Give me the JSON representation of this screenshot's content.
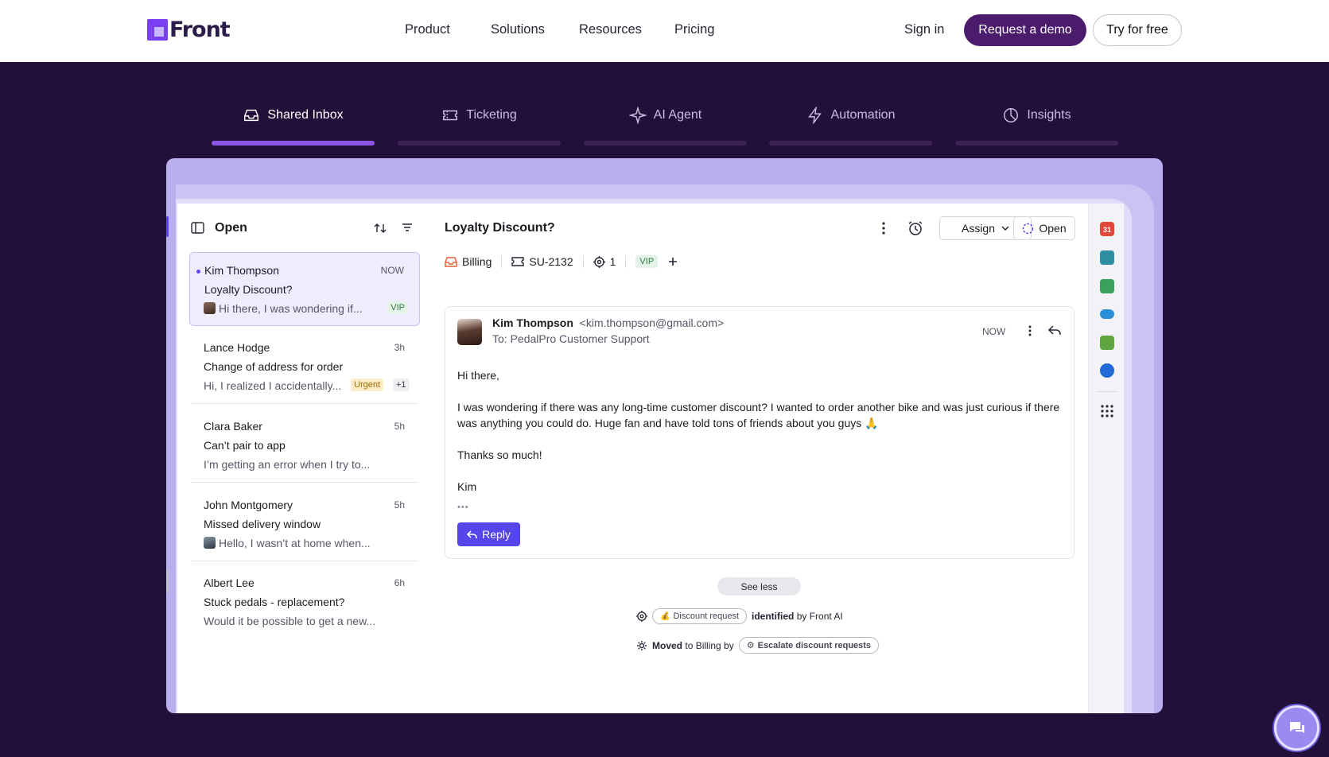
{
  "nav": {
    "logo": "Front",
    "links": [
      "Product",
      "Solutions",
      "Resources",
      "Pricing"
    ],
    "sign_in": "Sign in",
    "demo": "Request a demo",
    "try": "Try for free"
  },
  "tabs": [
    {
      "label": "Shared Inbox",
      "icon": "inbox-icon",
      "active": true
    },
    {
      "label": "Ticketing",
      "icon": "ticket-icon",
      "active": false
    },
    {
      "label": "AI Agent",
      "icon": "sparkle-icon",
      "active": false
    },
    {
      "label": "Automation",
      "icon": "bolt-icon",
      "active": false
    },
    {
      "label": "Insights",
      "icon": "pie-chart-icon",
      "active": false
    }
  ],
  "inbox": {
    "title": "Open",
    "conversations": [
      {
        "name": "Kim Thompson",
        "time": "NOW",
        "subject": "Loyalty Discount?",
        "preview": "Hi there, I was wondering if...",
        "badge": "VIP",
        "extra": ""
      },
      {
        "name": "Lance Hodge",
        "time": "3h",
        "subject": "Change of address for order",
        "preview": "Hi, I realized I accidentally...",
        "badge": "Urgent",
        "extra": "+1"
      },
      {
        "name": "Clara Baker",
        "time": "5h",
        "subject": "Can’t pair to app",
        "preview": "I’m getting an error when I try to...",
        "badge": "",
        "extra": ""
      },
      {
        "name": "John Montgomery",
        "time": "5h",
        "subject": "Missed delivery window",
        "preview": "Hello, I wasn’t at home when...",
        "badge": "",
        "extra": ""
      },
      {
        "name": "Albert Lee",
        "time": "6h",
        "subject": "Stuck pedals - replacement?",
        "preview": "Would it be possible to get a new...",
        "badge": "",
        "extra": ""
      }
    ]
  },
  "conversation": {
    "title": "Loyalty Discount?",
    "assign": "Assign",
    "status": "Open",
    "tags": {
      "inbox": "Billing",
      "ticket": "SU-2132",
      "watchers": "1",
      "vip": "VIP"
    },
    "message": {
      "from_name": "Kim Thompson",
      "from_email": "<kim.thompson@gmail.com>",
      "to": "To: PedalPro Customer Support",
      "time": "NOW",
      "greeting": "Hi there,",
      "body": "I was wondering if there was any long-time customer discount? I wanted to order another bike and was just curious if there was anything you could do. Huge fan and have told tons of friends about you guys 🙏",
      "thanks": "Thanks so much!",
      "signature": "Kim",
      "ellipsis": "•••",
      "reply": "Reply"
    },
    "see_less": "See less",
    "activity": [
      {
        "pill": "Discount request",
        "bold": "identified",
        "rest": "by Front AI"
      },
      {
        "bold": "Moved",
        "rest": "to Billing by",
        "pill": "Escalate discount requests"
      }
    ]
  },
  "colors": {
    "brand": "#4a1c6b",
    "accent": "#5645e9",
    "page_bg": "#22103a"
  }
}
